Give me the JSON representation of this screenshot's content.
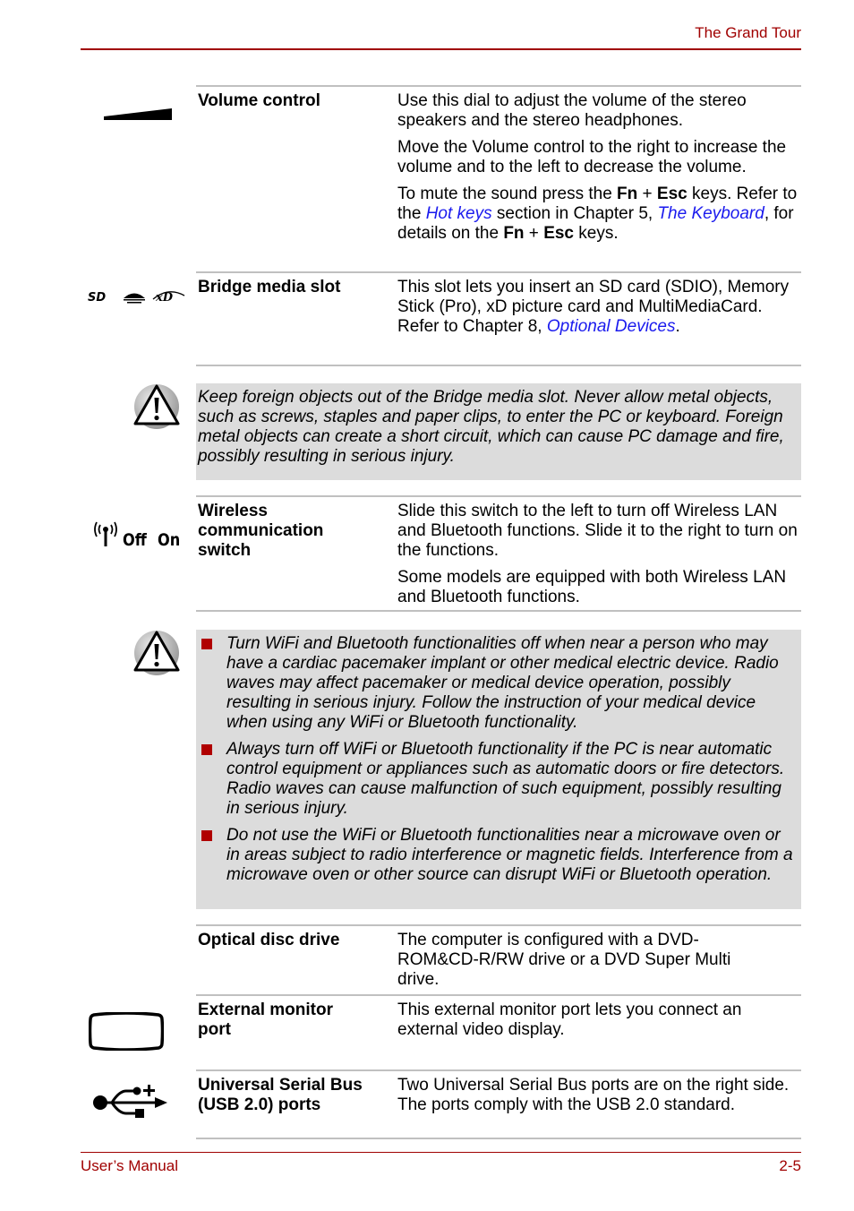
{
  "header": {
    "title": "The Grand Tour"
  },
  "footer": {
    "left": "User’s Manual",
    "right": "2-5"
  },
  "colors": {
    "accent": "#a00000",
    "link": "#1a1aee",
    "note_bg": "#dcdcdc",
    "bullet": "#b00000"
  },
  "volume": {
    "icon": "volume-wedge-icon",
    "term": "Volume control",
    "p1": "Use this dial to adjust the volume of the stereo speakers and the stereo headphones.",
    "p2": "Move the Volume control to the right to increase the volume and to the left to decrease the volume.",
    "p3_a": "To mute the sound press the ",
    "p3_fn": "Fn",
    "p3_plus": " + ",
    "p3_esc": "Esc",
    "p3_b": " keys. Refer to the ",
    "p3_link1": "Hot keys",
    "p3_c": " section in Chapter 5, ",
    "p3_link2": "The Keyboard",
    "p3_d": ", for details on the ",
    "p3_fn2": "Fn",
    "p3_plus2": " + ",
    "p3_esc2": "Esc",
    "p3_e": " keys."
  },
  "bridge": {
    "icon": "memory-card-logos-icon",
    "term": "Bridge media slot",
    "p1": "This slot lets you insert an SD card (SDIO), Memory Stick (Pro), xD picture card and MultiMediaCard. Refer to Chapter 8, ",
    "link": "Optional Devices",
    "p1_end": "."
  },
  "warning1": {
    "icon": "warning-icon",
    "text": "Keep foreign objects out of the Bridge media slot. Never allow metal objects, such as screws, staples and paper clips, to enter the PC or keyboard. Foreign metal objects can create a short circuit, which can cause PC damage and fire, possibly resulting in serious injury."
  },
  "wireless": {
    "icon": "wireless-antenna-icon",
    "icon_off": "Off",
    "icon_on": "On",
    "term": "Wireless communication switch",
    "p1": "Slide this switch to the left to turn off Wireless LAN and Bluetooth functions. Slide it to the right to turn on the functions.",
    "p2": "Some models are equipped with both Wireless LAN and Bluetooth functions."
  },
  "warning2": {
    "icon": "warning-icon",
    "items": [
      "Turn WiFi and Bluetooth functionalities off when near a person who may have a cardiac pacemaker implant or other medical electric device. Radio waves may affect pacemaker or medical device operation, possibly resulting in serious injury. Follow the instruction of your medical device when using any WiFi or Bluetooth functionality.",
      "Always turn off WiFi or Bluetooth functionality if the PC is near automatic control equipment or appliances such as automatic doors or fire detectors. Radio waves can cause malfunction of such equipment, possibly resulting in serious injury.",
      "Do not use the WiFi or Bluetooth functionalities near a microwave oven or in areas subject to radio interference or magnetic fields. Interference from a microwave oven or other source can disrupt WiFi or Bluetooth operation."
    ]
  },
  "optical": {
    "term": "Optical disc drive",
    "p1": "The computer is configured with a DVD-ROM&CD-R/RW drive or a DVD Super Multi drive."
  },
  "monitor": {
    "icon": "monitor-port-icon",
    "term": "External monitor port",
    "p1": "This external monitor port lets you connect an external video display."
  },
  "usb": {
    "icon": "usb-icon",
    "term": "Universal Serial Bus (USB 2.0) ports",
    "p1": "Two Universal Serial Bus ports are on the right side. The ports comply with the USB 2.0 standard."
  }
}
